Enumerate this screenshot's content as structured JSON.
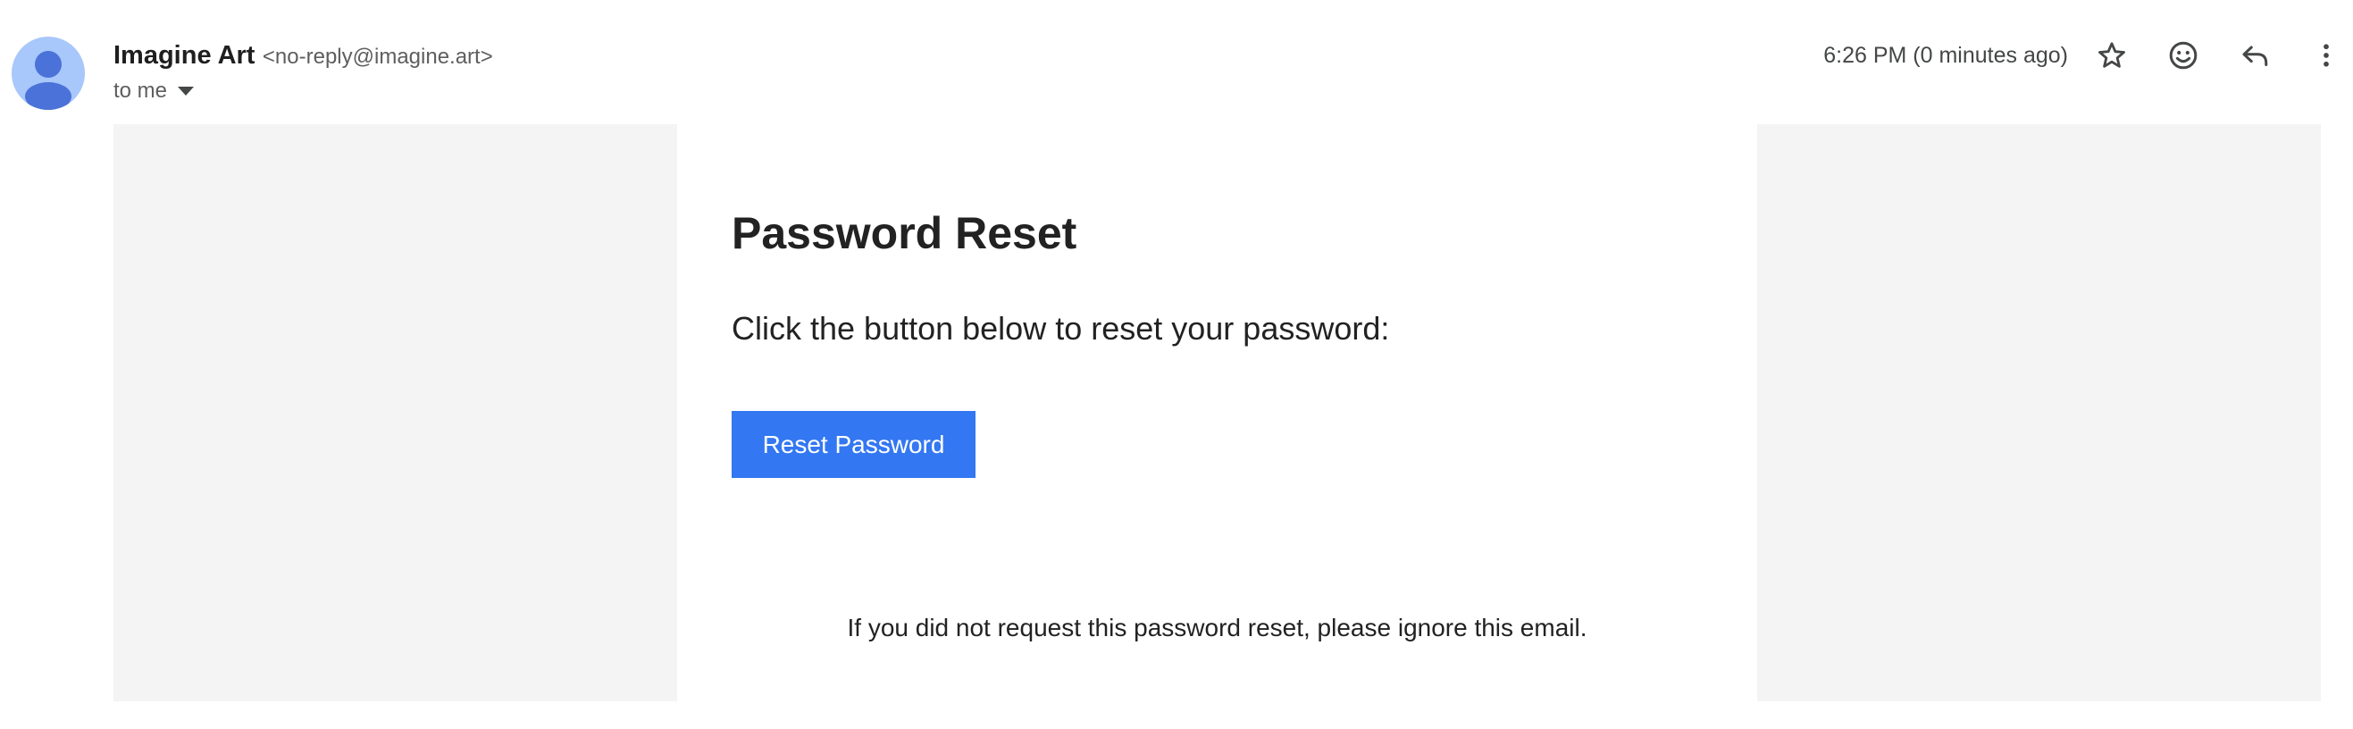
{
  "header": {
    "sender_name": "Imagine Art",
    "sender_email": "<no-reply@imagine.art>",
    "recipient": "to me",
    "timestamp": "6:26 PM (0 minutes ago)",
    "actions": [
      {
        "icon": "star-icon",
        "label": "Star"
      },
      {
        "icon": "emoji-icon",
        "label": "Add reaction"
      },
      {
        "icon": "reply-icon",
        "label": "Reply"
      },
      {
        "icon": "more-vert-icon",
        "label": "More"
      }
    ]
  },
  "email": {
    "title": "Password Reset",
    "instruction": "Click the button below to reset your password:",
    "button_label": "Reset Password",
    "footer_note": "If you did not request this password reset, please ignore this email."
  },
  "colors": {
    "button": "#3377f2",
    "avatar_bg": "#a8c7fa",
    "avatar_fg": "#4a72d9",
    "body_bg": "#f4f4f4"
  }
}
